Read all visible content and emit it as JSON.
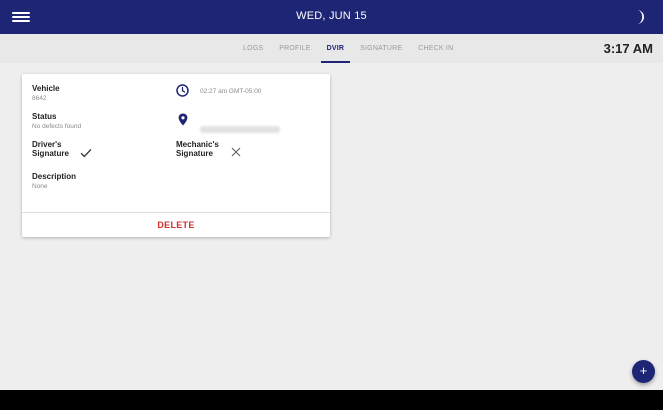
{
  "header": {
    "date": "WED, JUN 15",
    "menu_icon": "hamburger-menu-icon",
    "theme_icon": "moon-icon"
  },
  "tabs": [
    {
      "label": "LOGS",
      "active": false
    },
    {
      "label": "PROFILE",
      "active": false
    },
    {
      "label": "DVIR",
      "active": true
    },
    {
      "label": "SIGNATURE",
      "active": false
    },
    {
      "label": "CHECK IN",
      "active": false
    }
  ],
  "clock": "3:17 AM",
  "dvir_card": {
    "vehicle_label": "Vehicle",
    "vehicle_value": "8642",
    "time": "02:27 am GMT-05:00",
    "status_label": "Status",
    "status_value": "No defects found",
    "drivers_signature_label": [
      "Driver's",
      "Signature"
    ],
    "mechanics_signature_label": [
      "Mechanic's",
      "Signature"
    ],
    "description_label": "Description",
    "description_value": "None",
    "delete_label": "DELETE"
  },
  "fab_label": "+",
  "colors": {
    "primary": "#1e2574",
    "delete": "#d0312d",
    "tab_background": "#e8e8e8",
    "content_background": "#eeeeee"
  }
}
